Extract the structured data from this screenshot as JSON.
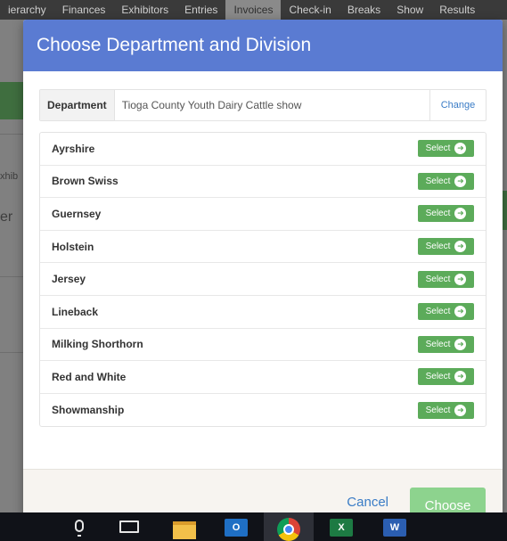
{
  "background": {
    "nav_items": [
      {
        "label": "ierarchy"
      },
      {
        "label": "Finances"
      },
      {
        "label": "Exhibitors"
      },
      {
        "label": "Entries"
      },
      {
        "label": "Invoices",
        "active": true
      },
      {
        "label": "Check-in"
      },
      {
        "label": "Breaks"
      },
      {
        "label": "Show"
      },
      {
        "label": "Results"
      }
    ],
    "partial_text_1": "xhib",
    "partial_text_2": "er"
  },
  "modal": {
    "title": "Choose Department and Division",
    "department": {
      "label": "Department",
      "value": "Tioga County Youth Dairy Cattle show",
      "change_label": "Change"
    },
    "divisions": [
      {
        "name": "Ayrshire",
        "button": "Select"
      },
      {
        "name": "Brown Swiss",
        "button": "Select"
      },
      {
        "name": "Guernsey",
        "button": "Select"
      },
      {
        "name": "Holstein",
        "button": "Select"
      },
      {
        "name": "Jersey",
        "button": "Select"
      },
      {
        "name": "Lineback",
        "button": "Select"
      },
      {
        "name": "Milking Shorthorn",
        "button": "Select"
      },
      {
        "name": "Red and White",
        "button": "Select"
      },
      {
        "name": "Showmanship",
        "button": "Select"
      }
    ],
    "footer": {
      "cancel_label": "Cancel",
      "choose_label": "Choose"
    }
  },
  "taskbar": {
    "icons": [
      "microphone-icon",
      "task-view-icon",
      "file-explorer-icon",
      "outlook-icon",
      "chrome-icon",
      "excel-icon",
      "word-icon"
    ],
    "outlook_letter": "O",
    "excel_letter": "X",
    "word_letter": "W"
  },
  "colors": {
    "header_blue": "#5a7bd2",
    "select_green": "#5cab5a",
    "choose_green": "#8dd38e",
    "link_blue": "#3a7cc6"
  }
}
